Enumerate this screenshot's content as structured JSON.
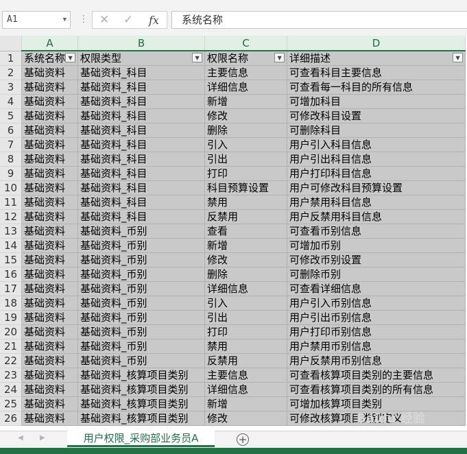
{
  "formula_bar": {
    "name_box": "A1",
    "cancel_icon": "✕",
    "enter_icon": "✓",
    "fx_label": "fx",
    "content": "系统名称"
  },
  "columns": [
    "A",
    "B",
    "C",
    "D"
  ],
  "header_row": {
    "row_num": "1",
    "cells": [
      "系统名称",
      "权限类型",
      "权限名称",
      "详细描述"
    ]
  },
  "rows": [
    {
      "num": "2",
      "cells": [
        "基础资料",
        "基础资料_科目",
        "主要信息",
        "可查看科目主要信息"
      ]
    },
    {
      "num": "3",
      "cells": [
        "基础资料",
        "基础资料_科目",
        "详细信息",
        "可查看每一科目的所有信息"
      ]
    },
    {
      "num": "4",
      "cells": [
        "基础资料",
        "基础资料_科目",
        "新增",
        "可增加科目"
      ]
    },
    {
      "num": "5",
      "cells": [
        "基础资料",
        "基础资料_科目",
        "修改",
        "可修改科目设置"
      ]
    },
    {
      "num": "6",
      "cells": [
        "基础资料",
        "基础资料_科目",
        "删除",
        "可删除科目"
      ]
    },
    {
      "num": "7",
      "cells": [
        "基础资料",
        "基础资料_科目",
        "引入",
        "用户引入科目信息"
      ]
    },
    {
      "num": "8",
      "cells": [
        "基础资料",
        "基础资料_科目",
        "引出",
        "用户引出科目信息"
      ]
    },
    {
      "num": "9",
      "cells": [
        "基础资料",
        "基础资料_科目",
        "打印",
        "用户打印科目信息"
      ]
    },
    {
      "num": "10",
      "cells": [
        "基础资料",
        "基础资料_科目",
        "科目预算设置",
        "用户可修改科目预算设置"
      ]
    },
    {
      "num": "11",
      "cells": [
        "基础资料",
        "基础资料_科目",
        "禁用",
        "用户禁用科目信息"
      ]
    },
    {
      "num": "12",
      "cells": [
        "基础资料",
        "基础资料_科目",
        "反禁用",
        "用户反禁用科目信息"
      ]
    },
    {
      "num": "13",
      "cells": [
        "基础资料",
        "基础资料_币别",
        "查看",
        "可查看币别信息"
      ]
    },
    {
      "num": "14",
      "cells": [
        "基础资料",
        "基础资料_币别",
        "新增",
        "可增加币别"
      ]
    },
    {
      "num": "15",
      "cells": [
        "基础资料",
        "基础资料_币别",
        "修改",
        "可修改币别设置"
      ]
    },
    {
      "num": "16",
      "cells": [
        "基础资料",
        "基础资料_币别",
        "删除",
        "可删除币别"
      ]
    },
    {
      "num": "17",
      "cells": [
        "基础资料",
        "基础资料_币别",
        "详细信息",
        "可查看详细信息"
      ]
    },
    {
      "num": "18",
      "cells": [
        "基础资料",
        "基础资料_币别",
        "引入",
        "用户引入币别信息"
      ]
    },
    {
      "num": "19",
      "cells": [
        "基础资料",
        "基础资料_币别",
        "引出",
        "用户引出币别信息"
      ]
    },
    {
      "num": "20",
      "cells": [
        "基础资料",
        "基础资料_币别",
        "打印",
        "用户打印币别信息"
      ]
    },
    {
      "num": "21",
      "cells": [
        "基础资料",
        "基础资料_币别",
        "禁用",
        "用户禁用币别信息"
      ]
    },
    {
      "num": "22",
      "cells": [
        "基础资料",
        "基础资料_币别",
        "反禁用",
        "用户反禁用币别信息"
      ]
    },
    {
      "num": "23",
      "cells": [
        "基础资料",
        "基础资料_核算项目类别",
        "主要信息",
        "可查看核算项目类别的主要信息"
      ]
    },
    {
      "num": "24",
      "cells": [
        "基础资料",
        "基础资料_核算项目类别",
        "详细信息",
        "可查看核算项目类别的所有信息"
      ]
    },
    {
      "num": "25",
      "cells": [
        "基础资料",
        "基础资料_核算项目类别",
        "新增",
        "可增加核算项目类别"
      ]
    },
    {
      "num": "26",
      "cells": [
        "基础资料",
        "基础资料_核算项目类别",
        "修改",
        "可修改核算项目类别定义"
      ]
    }
  ],
  "sheet_tab": "用户权限_采购部业务员A",
  "add_sheet": "+",
  "colors": {
    "accent": "#217346",
    "selection": "#c9c9c9",
    "col_header_selected": "#e1efe4"
  }
}
